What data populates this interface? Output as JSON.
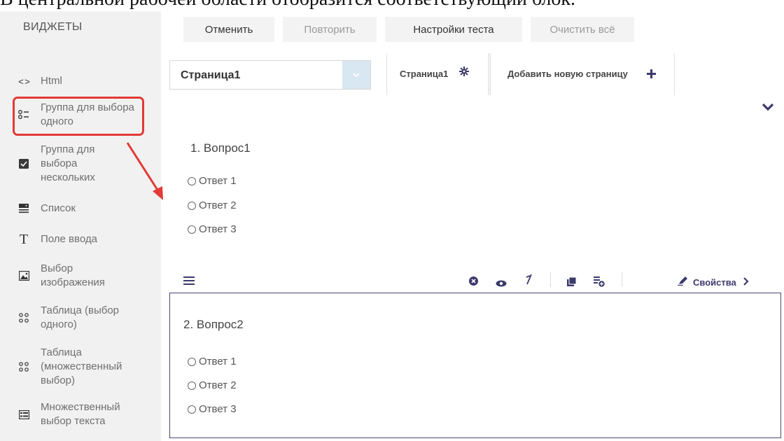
{
  "doc": {
    "caption": "В центральной рабочей области отобразится соответствующий блок."
  },
  "sidebar": {
    "title": "ВИДЖЕТЫ",
    "items": [
      {
        "label": "Html",
        "icon": "code-icon"
      },
      {
        "label": "Группа для выбора одного",
        "icon": "radiogroup-icon"
      },
      {
        "label": "Группа для выбора нескольких",
        "icon": "checkbox-icon"
      },
      {
        "label": "Список",
        "icon": "dropdown-icon"
      },
      {
        "label": "Поле ввода",
        "icon": "text-icon"
      },
      {
        "label": "Выбор изображения",
        "icon": "image-icon"
      },
      {
        "label": "Таблица (выбор одного)",
        "icon": "matrix-icon"
      },
      {
        "label": "Таблица (множественный выбор)",
        "icon": "matrix-multi-icon"
      },
      {
        "label": "Множественный выбор текста",
        "icon": "multitext-icon"
      }
    ]
  },
  "toolbar": {
    "undo": "Отменить",
    "redo": "Повторить",
    "settings": "Настройки теста",
    "clear": "Очистить всё"
  },
  "page_select": {
    "value": "Страница1"
  },
  "tabs": {
    "page1": "Страница1",
    "add_page": "Добавить новую страницу"
  },
  "question1": {
    "title": "1. Вопрос1",
    "answers": [
      "Ответ 1",
      "Ответ 2",
      "Ответ 3"
    ]
  },
  "question2": {
    "title": "2. Вопрос2",
    "answers": [
      "Ответ 1",
      "Ответ 2",
      "Ответ 3"
    ],
    "properties": "Свойства"
  },
  "colors": {
    "accent": "#3c3a6b",
    "highlight": "#e23a35",
    "sidebar_bg": "#f1f1f1"
  }
}
